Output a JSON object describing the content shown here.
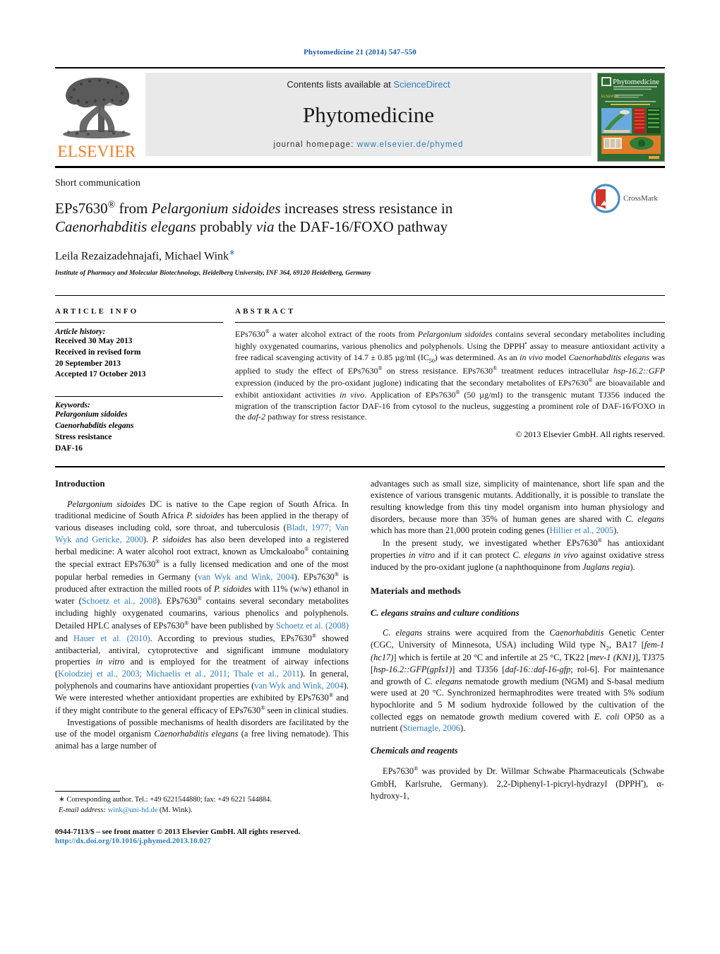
{
  "running_head": "Phytomedicine 21 (2014) 547–550",
  "masthead": {
    "publisher_name": "ELSEVIER",
    "contents_prefix": "Contents lists available at ",
    "contents_link": "ScienceDirect",
    "journal_title": "Phytomedicine",
    "homepage_prefix": "journal homepage: ",
    "homepage_url": "www.elsevier.de/phymed",
    "cover_title": "Phytomedicine",
    "cover_subtitle": "International Journal of Phytotherapy and Phytopharmacology"
  },
  "article": {
    "category": "Short communication",
    "title_line1_a": "EPs7630",
    "title_line1_reg": "®",
    "title_line1_b": " from ",
    "title_line1_italic": "Pelargonium sidoides",
    "title_line1_c": " increases stress resistance in",
    "title_line2_italic": "Caenorhabditis elegans",
    "title_line2_a": " probably ",
    "title_line2_via": "via",
    "title_line2_b": " the DAF-16/FOXO pathway",
    "authors": "Leila Rezaizadehnajafi, Michael Wink",
    "author_marker": "∗",
    "affiliation": "Institute of Pharmacy and Molecular Biotechnology, Heidelberg University, INF 364, 69120 Heidelberg, Germany",
    "crossmark_label": "CrossMark"
  },
  "article_info": {
    "heading": "ARTICLE INFO",
    "history_label": "Article history:",
    "history": [
      "Received 30 May 2013",
      "Received in revised form",
      "20 September 2013",
      "Accepted 17 October 2013"
    ],
    "keywords_label": "Keywords:",
    "keywords": [
      {
        "text": "Pelargonium sidoides",
        "italic": true
      },
      {
        "text": "Caenorhabditis elegans",
        "italic": true
      },
      {
        "text": "Stress resistance",
        "italic": false
      },
      {
        "text": "DAF-16",
        "italic": false
      }
    ]
  },
  "abstract": {
    "heading": "ABSTRACT",
    "copyright": "© 2013 Elsevier GmbH. All rights reserved."
  },
  "sections": {
    "introduction_heading": "Introduction",
    "materials_heading": "Materials and methods",
    "strains_subheading": "C. elegans strains and culture conditions",
    "chemicals_subheading": "Chemicals and reagents"
  },
  "footnote": {
    "corresponding": "∗ Corresponding author. Tel.: +49 6221544880; fax: +49 6221 544884.",
    "email_label": "E-mail address:",
    "email": "wink@uni-hd.de",
    "email_suffix": "(M. Wink).",
    "issn_line": "0944-7113/$ – see front matter © 2013 Elsevier GmbH. All rights reserved.",
    "doi": "http://dx.doi.org/10.1016/j.phymed.2013.10.027"
  },
  "colors": {
    "link": "#2E7EBB",
    "runhead": "#1a5aa8",
    "elsevier_orange": "#F47B20",
    "banner_bg": "#e9e9e9"
  }
}
